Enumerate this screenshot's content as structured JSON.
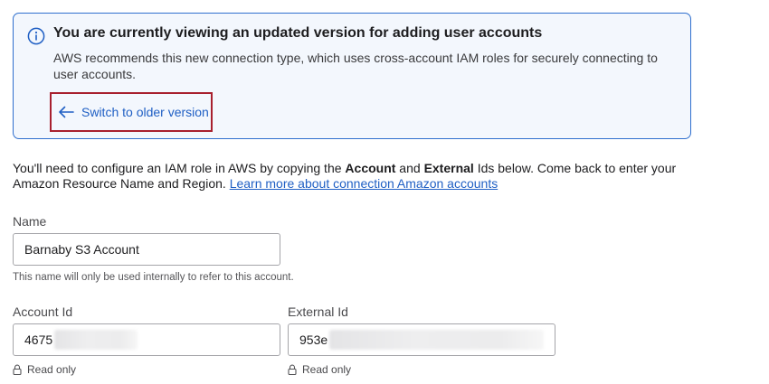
{
  "banner": {
    "icon": "info-icon",
    "title": "You are currently viewing an updated version for adding user accounts",
    "body": "AWS recommends this new connection type, which uses cross-account IAM roles for securely connecting to user accounts.",
    "switch_icon": "arrow-left-icon",
    "switch_label": "Switch to older version",
    "accent_color": "#2f6fce",
    "highlight_color": "#a8202e"
  },
  "instructions": {
    "text_1": "You'll need to configure an IAM role in AWS by copying the ",
    "bold_1": "Account",
    "text_2": " and ",
    "bold_2": "External",
    "text_3": " Ids below. Come back to enter your Amazon Resource Name and Region. ",
    "link": "Learn more about connection Amazon accounts"
  },
  "form": {
    "name": {
      "label": "Name",
      "value": "Barnaby S3 Account",
      "hint": "This name will only be used internally to refer to this account."
    },
    "account_id": {
      "label": "Account Id",
      "visible_value": "4675",
      "status_icon": "lock-icon",
      "status": "Read only"
    },
    "external_id": {
      "label": "External Id",
      "visible_value": "953е",
      "status_icon": "lock-icon",
      "status": "Read only"
    }
  }
}
